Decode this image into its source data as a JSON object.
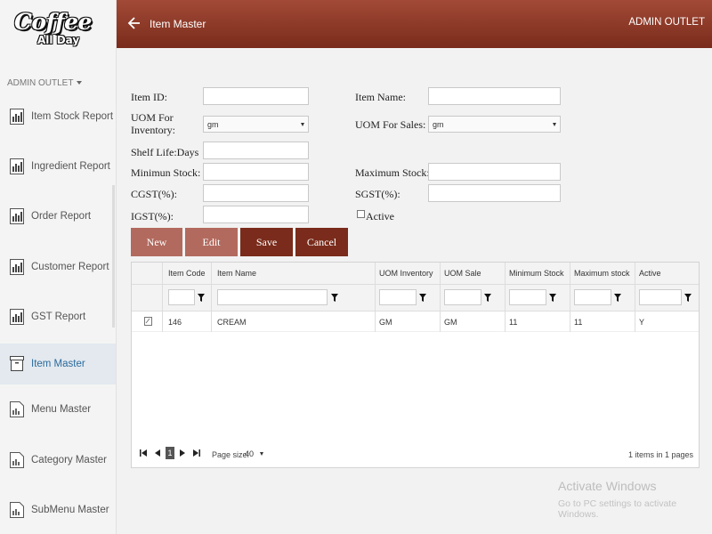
{
  "brand": {
    "logo_line1": "Coffee",
    "logo_line2": "All Day"
  },
  "sidebar": {
    "outlet": "ADMIN OUTLET",
    "items": [
      {
        "label": "Item Stock Report",
        "icon": "bar-chart-icon"
      },
      {
        "label": "Ingredient Report",
        "icon": "bar-chart-icon"
      },
      {
        "label": "Order Report",
        "icon": "bar-chart-icon"
      },
      {
        "label": "Customer Report",
        "icon": "bar-chart-icon"
      },
      {
        "label": "GST Report",
        "icon": "bar-chart-icon"
      },
      {
        "label": "Item Master",
        "icon": "box-icon",
        "active": true
      },
      {
        "label": "Menu Master",
        "icon": "document-icon"
      },
      {
        "label": "Category Master",
        "icon": "document-icon"
      },
      {
        "label": "SubMenu Master",
        "icon": "document-icon"
      }
    ]
  },
  "header": {
    "title": "Item Master",
    "outlet": "ADMIN OUTLET"
  },
  "form": {
    "item_id": {
      "label": "Item ID:",
      "value": ""
    },
    "item_name": {
      "label": "Item Name:",
      "value": ""
    },
    "uom_inventory": {
      "label": "UOM For Inventory:",
      "value": "gm"
    },
    "uom_sales": {
      "label": "UOM For Sales:",
      "value": "gm"
    },
    "shelf_life": {
      "label": "Shelf Life:Days",
      "value": ""
    },
    "min_stock": {
      "label": "Minimun Stock:",
      "value": ""
    },
    "max_stock": {
      "label": "Maximum Stock:",
      "value": ""
    },
    "cgst": {
      "label": "CGST(%):",
      "value": ""
    },
    "sgst": {
      "label": "SGST(%):",
      "value": ""
    },
    "igst": {
      "label": "IGST(%):",
      "value": ""
    },
    "active": {
      "label": "Active",
      "checked": false
    }
  },
  "buttons": {
    "new": "New",
    "edit": "Edit",
    "save": "Save",
    "cancel": "Cancel"
  },
  "grid": {
    "columns": [
      "Item Code",
      "Item Name",
      "UOM Inventory",
      "UOM Sale",
      "Minimum Stock",
      "Maximum stock",
      "Active"
    ],
    "rows": [
      [
        "146",
        "CREAM",
        "GM",
        "GM",
        "11",
        "11",
        "Y"
      ]
    ],
    "pager": {
      "current_page": "1",
      "page_size_label": "Page size:",
      "page_size": "40",
      "info": "1 items in 1 pages"
    }
  },
  "watermark": {
    "line1": "Activate Windows",
    "line2": "Go to PC settings to activate Windows."
  },
  "colors": {
    "header": "#8a3422",
    "button_light": "#b26a5e",
    "button_dark": "#7a2b1b",
    "active_nav_text": "#2a6a9c"
  }
}
